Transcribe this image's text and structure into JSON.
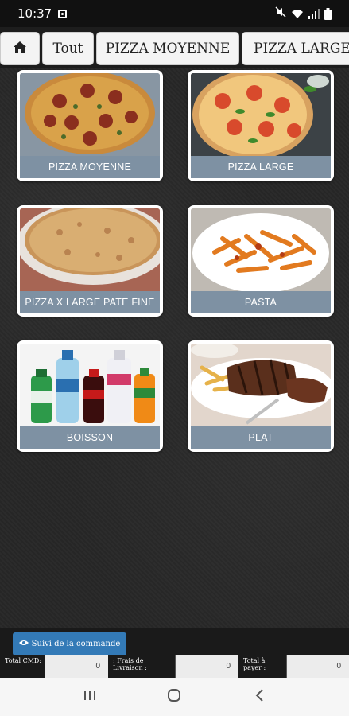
{
  "status_bar": {
    "time": "10:37"
  },
  "tabs": [
    {
      "label": "",
      "icon": "home-icon"
    },
    {
      "label": "Tout"
    },
    {
      "label": "PIZZA MOYENNE"
    },
    {
      "label": "PIZZA LARGE"
    }
  ],
  "categories": [
    {
      "label": "PIZZA MOYENNE",
      "image": "pizza-moyenne-image"
    },
    {
      "label": "PIZZA LARGE",
      "image": "pizza-large-image"
    },
    {
      "label": "PIZZA X LARGE PATE FINE",
      "image": "pizza-xlarge-image"
    },
    {
      "label": "PASTA",
      "image": "pasta-image"
    },
    {
      "label": "BOISSON",
      "image": "boisson-image"
    },
    {
      "label": "PLAT",
      "image": "plat-image"
    }
  ],
  "order": {
    "track_button_label": "Suivi de la commande",
    "track_icon": "eye-icon"
  },
  "totals": {
    "total_cmd_label": "Total CMD:",
    "total_cmd_value": "0",
    "delivery_label": ": Frais de Livraison :",
    "delivery_value": "0",
    "to_pay_label": "Total à payer :",
    "to_pay_value": "0"
  },
  "colors": {
    "label_bg": "#7e91a3",
    "button_bg": "#337ab7"
  }
}
